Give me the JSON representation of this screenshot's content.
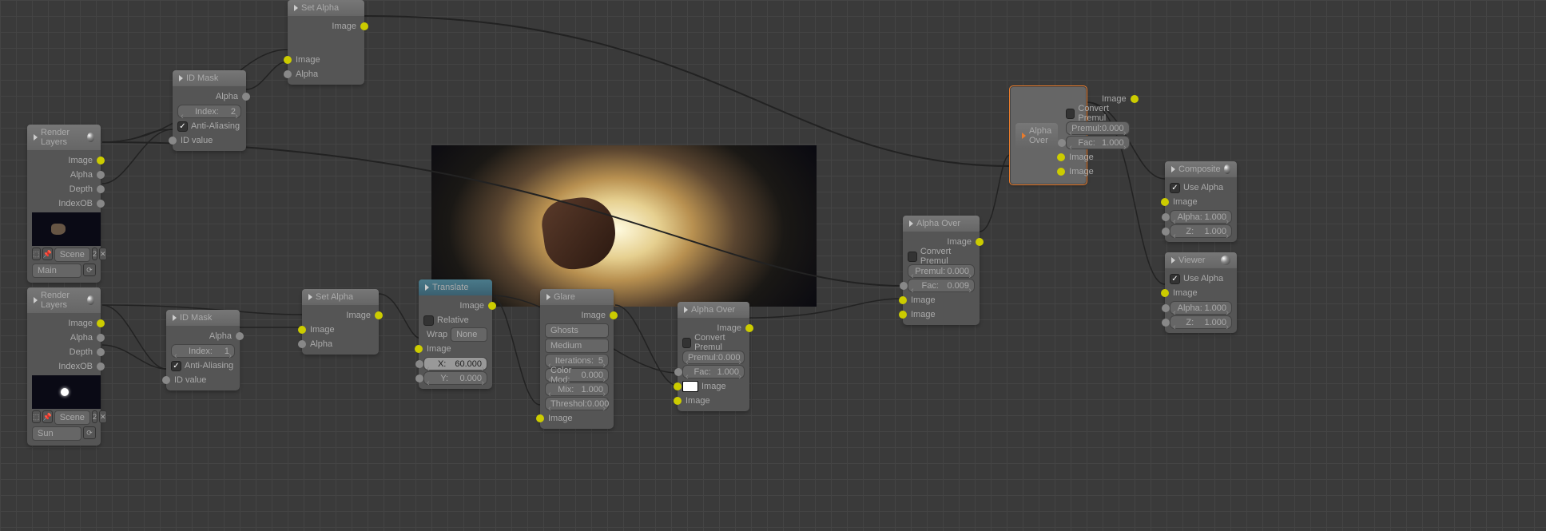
{
  "renderLayers1": {
    "title": "Render Layers",
    "outputs": [
      "Image",
      "Alpha",
      "Depth",
      "IndexOB"
    ],
    "scene": "Scene",
    "sceneNum": "2",
    "layer": "Main"
  },
  "renderLayers2": {
    "title": "Render Layers",
    "outputs": [
      "Image",
      "Alpha",
      "Depth",
      "IndexOB"
    ],
    "scene": "Scene",
    "sceneNum": "2",
    "layer": "Sun"
  },
  "idMask1": {
    "title": "ID Mask",
    "output": "Alpha",
    "indexLabel": "Index:",
    "indexVal": "2",
    "aa": "Anti-Aliasing",
    "input": "ID value"
  },
  "idMask2": {
    "title": "ID Mask",
    "output": "Alpha",
    "indexLabel": "Index:",
    "indexVal": "1",
    "aa": "Anti-Aliasing",
    "input": "ID value"
  },
  "setAlpha1": {
    "title": "Set Alpha",
    "output": "Image",
    "inputs": [
      "Image",
      "Alpha"
    ]
  },
  "setAlpha2": {
    "title": "Set Alpha",
    "output": "Image",
    "inputs": [
      "Image",
      "Alpha"
    ]
  },
  "translate": {
    "title": "Translate",
    "output": "Image",
    "relative": "Relative",
    "wrap": "Wrap",
    "wrapVal": "None",
    "input": "Image",
    "xLabel": "X:",
    "xVal": "60.000",
    "yLabel": "Y:",
    "yVal": "0.000"
  },
  "glare": {
    "title": "Glare",
    "output": "Image",
    "type": "Ghosts",
    "quality": "Medium",
    "iterLabel": "Iterations:",
    "iterVal": "5",
    "colorModLabel": "Color Mod:",
    "colorModVal": "0.000",
    "mixLabel": "Mix:",
    "mixVal": "1.000",
    "threshLabel": "Threshol:",
    "threshVal": "0.000",
    "input": "Image"
  },
  "alphaOver1": {
    "title": "Alpha Over",
    "output": "Image",
    "convert": "Convert Premul",
    "premulLabel": "Premul:",
    "premulVal": "0.000",
    "facLabel": "Fac:",
    "facVal": "1.000",
    "inputs": [
      "Image",
      "Image"
    ]
  },
  "alphaOver2": {
    "title": "Alpha Over",
    "output": "Image",
    "convert": "Convert Premul",
    "premulLabel": "Premul:",
    "premulVal": "0.000",
    "facLabel": "Fac:",
    "facVal": "0.009",
    "inputs": [
      "Image",
      "Image"
    ]
  },
  "alphaOver3": {
    "title": "Alpha Over",
    "output": "Image",
    "convert": "Convert Premul",
    "premulLabel": "Premul:",
    "premulVal": "0.000",
    "facLabel": "Fac:",
    "facVal": "1.000",
    "inputs": [
      "Image",
      "Image"
    ]
  },
  "composite": {
    "title": "Composite",
    "useAlpha": "Use Alpha",
    "input": "Image",
    "alphaLabel": "Alpha:",
    "alphaVal": "1.000",
    "zLabel": "Z:",
    "zVal": "1.000"
  },
  "viewer": {
    "title": "Viewer",
    "useAlpha": "Use Alpha",
    "input": "Image",
    "alphaLabel": "Alpha:",
    "alphaVal": "1.000",
    "zLabel": "Z:",
    "zVal": "1.000"
  }
}
